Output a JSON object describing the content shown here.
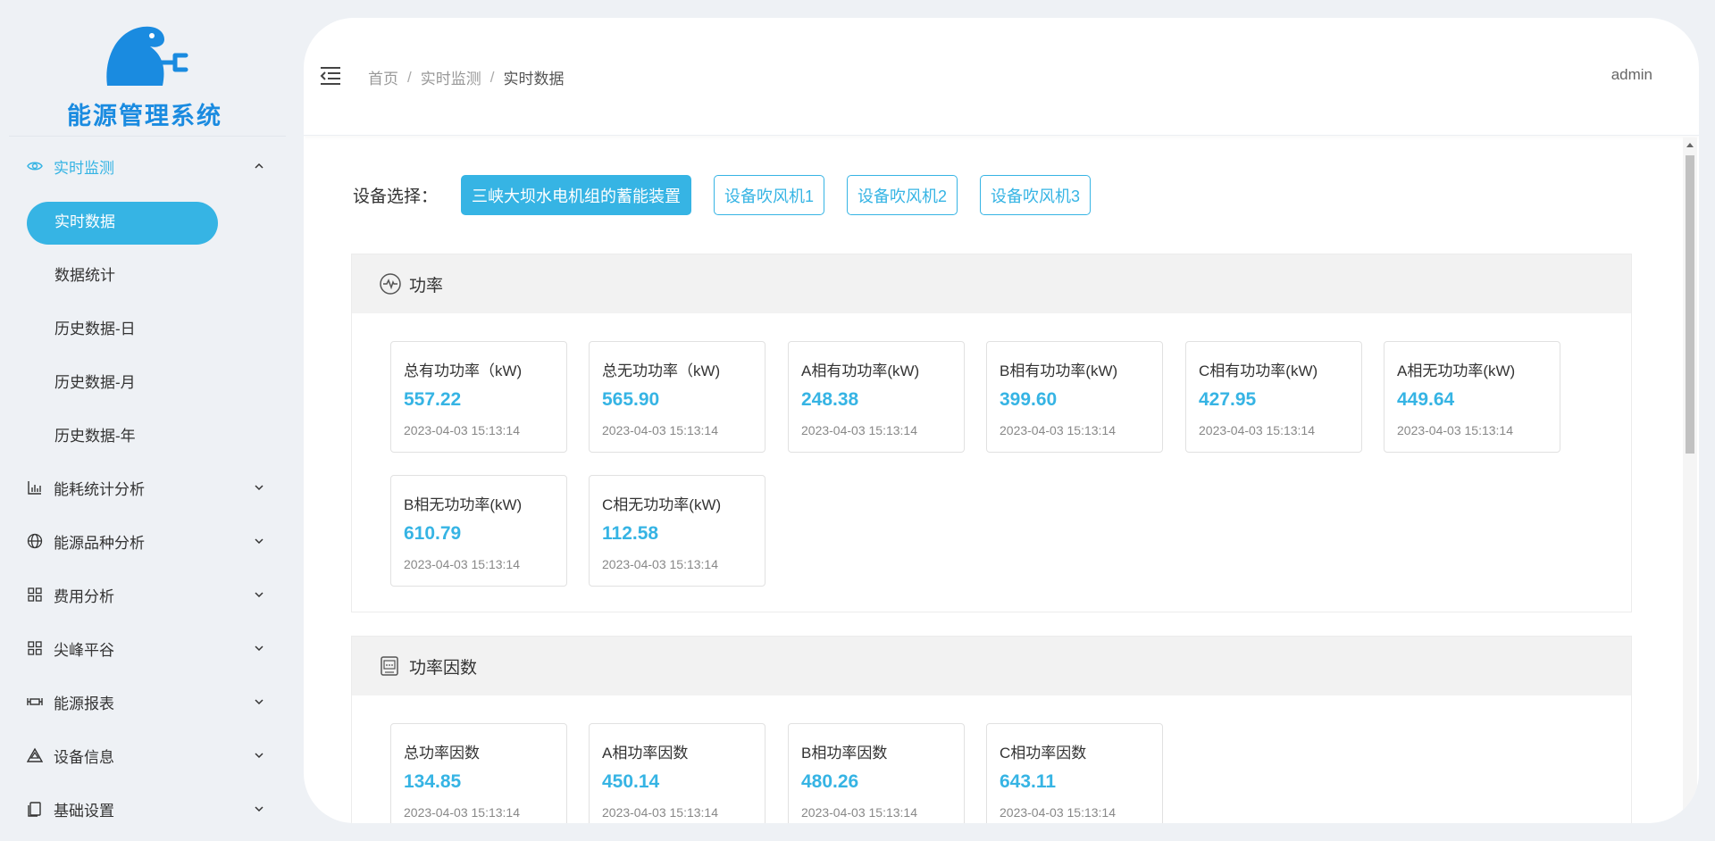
{
  "app": {
    "title": "能源管理系统"
  },
  "sidebar": {
    "items": [
      {
        "label": "实时监测",
        "icon": "eye-icon",
        "open": true,
        "children": [
          {
            "label": "实时数据",
            "active": true
          },
          {
            "label": "数据统计"
          },
          {
            "label": "历史数据-日"
          },
          {
            "label": "历史数据-月"
          },
          {
            "label": "历史数据-年"
          }
        ]
      },
      {
        "label": "能耗统计分析",
        "icon": "bar-chart-icon"
      },
      {
        "label": "能源品种分析",
        "icon": "globe-icon"
      },
      {
        "label": "费用分析",
        "icon": "grid-icon"
      },
      {
        "label": "尖峰平谷",
        "icon": "grid-icon"
      },
      {
        "label": "能源报表",
        "icon": "report-icon"
      },
      {
        "label": "设备信息",
        "icon": "warning-triangle-icon"
      },
      {
        "label": "基础设置",
        "icon": "copy-icon"
      }
    ]
  },
  "header": {
    "breadcrumb": [
      "首页",
      "实时监测",
      "实时数据"
    ],
    "user": "admin"
  },
  "device_select": {
    "label": "设备选择：",
    "options": [
      "三峡大坝水电机组的蓄能装置",
      "设备吹风机1",
      "设备吹风机2",
      "设备吹风机3"
    ],
    "selected": "三峡大坝水电机组的蓄能装置"
  },
  "sections": [
    {
      "title": "功率",
      "icon": "pulse-icon",
      "cards": [
        {
          "label": "总有功功率（kW)",
          "value": "557.22",
          "time": "2023-04-03 15:13:14"
        },
        {
          "label": "总无功功率（kW)",
          "value": "565.90",
          "time": "2023-04-03 15:13:14"
        },
        {
          "label": "A相有功功率(kW)",
          "value": "248.38",
          "time": "2023-04-03 15:13:14"
        },
        {
          "label": "B相有功功率(kW)",
          "value": "399.60",
          "time": "2023-04-03 15:13:14"
        },
        {
          "label": "C相有功功率(kW)",
          "value": "427.95",
          "time": "2023-04-03 15:13:14"
        },
        {
          "label": "A相无功功率(kW)",
          "value": "449.64",
          "time": "2023-04-03 15:13:14"
        },
        {
          "label": "B相无功功率(kW)",
          "value": "610.79",
          "time": "2023-04-03 15:13:14"
        },
        {
          "label": "C相无功功率(kW)",
          "value": "112.58",
          "time": "2023-04-03 15:13:14"
        }
      ]
    },
    {
      "title": "功率因数",
      "icon": "cos-meter-icon",
      "cards": [
        {
          "label": "总功率因数",
          "value": "134.85",
          "time": "2023-04-03 15:13:14"
        },
        {
          "label": "A相功率因数",
          "value": "450.14",
          "time": "2023-04-03 15:13:14"
        },
        {
          "label": "B相功率因数",
          "value": "480.26",
          "time": "2023-04-03 15:13:14"
        },
        {
          "label": "C相功率因数",
          "value": "643.11",
          "time": "2023-04-03 15:13:14"
        }
      ]
    }
  ],
  "colors": {
    "accent": "#36b4e4",
    "logo": "#1a8be0",
    "sidebar_bg": "#eef1f5"
  }
}
